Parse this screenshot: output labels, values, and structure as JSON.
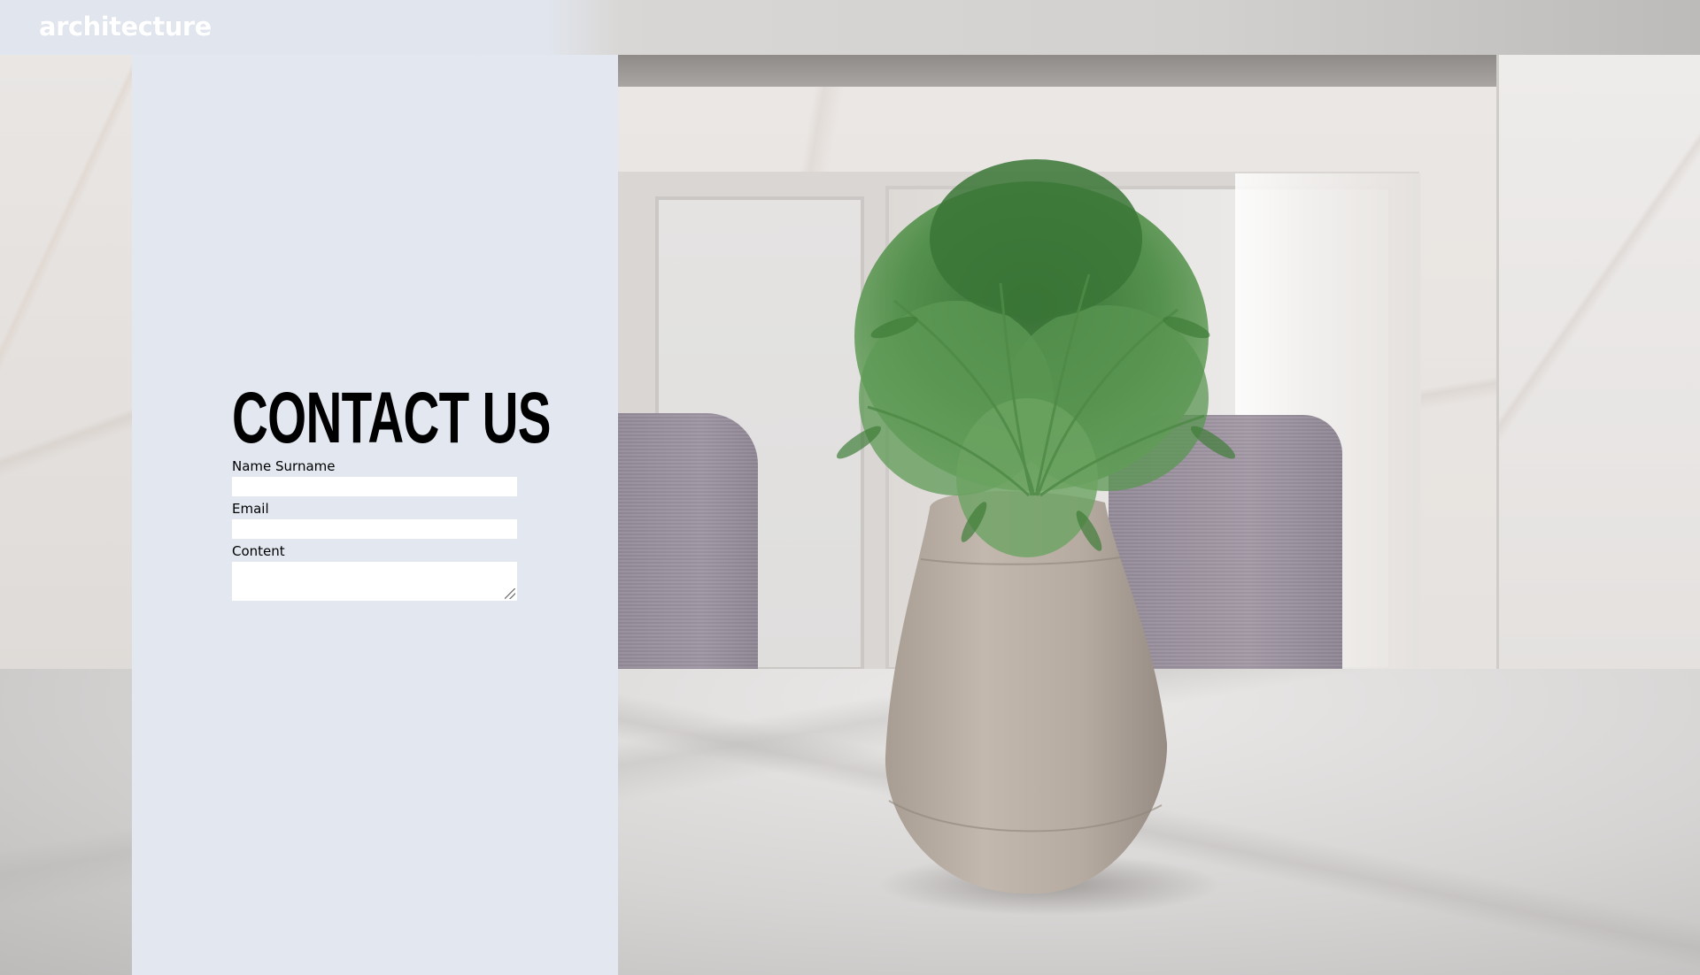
{
  "header": {
    "brand": "architecture"
  },
  "contact": {
    "title": "CONTACT US",
    "fields": {
      "name": {
        "label": "Name Surname",
        "value": ""
      },
      "email": {
        "label": "Email",
        "value": ""
      },
      "content": {
        "label": "Content",
        "value": ""
      }
    }
  },
  "colors": {
    "panel_background": "#e2e7f0",
    "heading_text": "#000000",
    "brand_text": "#ffffff",
    "input_background": "#ffffff"
  }
}
